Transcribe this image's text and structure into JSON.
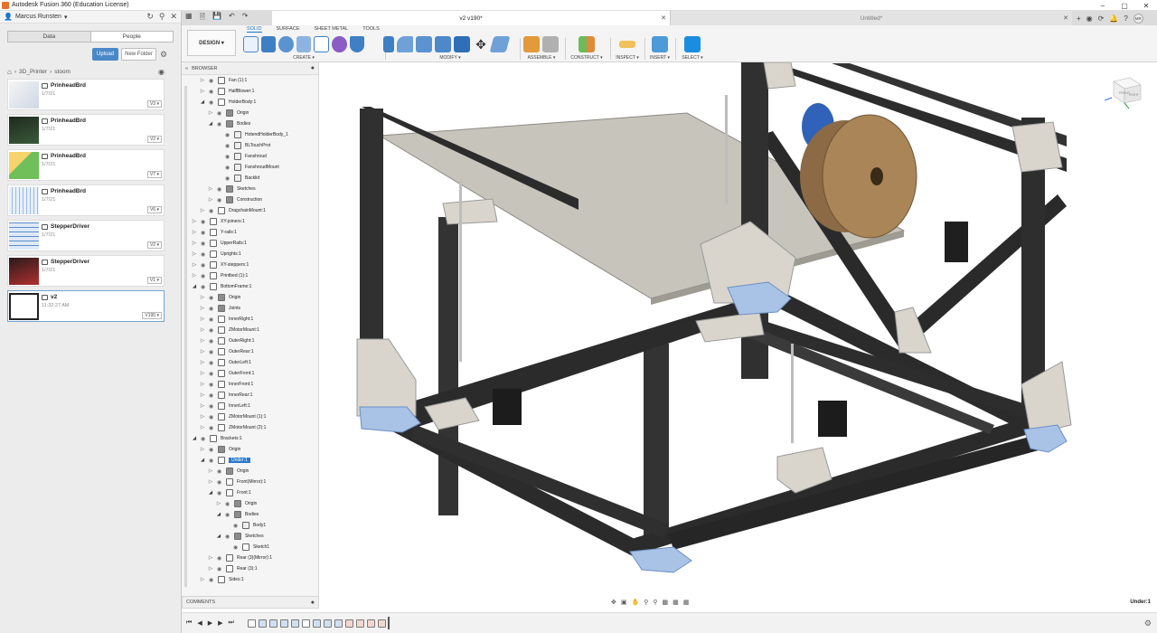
{
  "window": {
    "title": "Autodesk Fusion 360 (Education License)",
    "controls": [
      "–",
      "▢",
      "✕"
    ]
  },
  "data_panel": {
    "user": "Marcus Runsten",
    "tabs": [
      {
        "label": "Data",
        "active": true
      },
      {
        "label": "People",
        "active": false
      }
    ],
    "upload_label": "Upload",
    "new_folder_label": "New Folder",
    "breadcrumb": [
      "3D_Printer",
      "stoom"
    ],
    "files": [
      {
        "name": "PrinheadBrd",
        "date": "1/7/21",
        "version": "V3",
        "thumb": "pcb-sketch"
      },
      {
        "name": "PrinheadBrd",
        "date": "1/7/21",
        "version": "V2",
        "thumb": "pcb-dark"
      },
      {
        "name": "PrinheadBrd",
        "date": "1/7/21",
        "version": "V7",
        "thumb": "pcb-colored"
      },
      {
        "name": "PrinheadBrd",
        "date": "1/7/21",
        "version": "V6",
        "thumb": "pcb-schematic"
      },
      {
        "name": "StepperDriver",
        "date": "1/7/21",
        "version": "V2",
        "thumb": "schematic-blue"
      },
      {
        "name": "StepperDriver",
        "date": "1/7/21",
        "version": "V1",
        "thumb": "pcb-red"
      },
      {
        "name": "v2",
        "date": "11:32:27 AM",
        "version": "V190",
        "thumb": "frame-3d",
        "selected": true
      }
    ]
  },
  "doc_tabs": [
    {
      "label": "v2 v190*",
      "active": true
    },
    {
      "label": "Untitled*",
      "active": false
    }
  ],
  "user_initials": "MR",
  "toolbar": {
    "workspace_label": "DESIGN ▾",
    "workspace_tabs": [
      {
        "label": "SOLID",
        "active": true
      },
      {
        "label": "SURFACE",
        "active": false
      },
      {
        "label": "SHEET METAL",
        "active": false
      },
      {
        "label": "TOOLS",
        "active": false
      }
    ],
    "groups": [
      {
        "label": "CREATE ▾"
      },
      {
        "label": "MODIFY ▾"
      },
      {
        "label": "ASSEMBLE ▾"
      },
      {
        "label": "CONSTRUCT ▾"
      },
      {
        "label": "INSPECT ▾"
      },
      {
        "label": "INSERT ▾"
      },
      {
        "label": "SELECT ▾"
      }
    ]
  },
  "browser": {
    "title": "BROWSER",
    "tree": [
      {
        "label": "Fan (1):1",
        "depth": 3,
        "exp": "closed",
        "icon": "comp"
      },
      {
        "label": "HalfBlower:1",
        "depth": 3,
        "exp": "closed",
        "icon": "comp"
      },
      {
        "label": "HolderBody:1",
        "depth": 3,
        "exp": "open",
        "icon": "comp"
      },
      {
        "label": "Origin",
        "depth": 4,
        "exp": "closed",
        "icon": "folder"
      },
      {
        "label": "Bodies",
        "depth": 4,
        "exp": "open",
        "icon": "folder"
      },
      {
        "label": "HotendHolderBody_1",
        "depth": 5,
        "exp": "none",
        "icon": "body"
      },
      {
        "label": "BLTouchProt",
        "depth": 5,
        "exp": "none",
        "icon": "body"
      },
      {
        "label": "Fanshroud",
        "depth": 5,
        "exp": "none",
        "icon": "body"
      },
      {
        "label": "FanshroudMount",
        "depth": 5,
        "exp": "none",
        "icon": "body"
      },
      {
        "label": "Backlid",
        "depth": 5,
        "exp": "none",
        "icon": "body"
      },
      {
        "label": "Sketches",
        "depth": 4,
        "exp": "closed",
        "icon": "folder"
      },
      {
        "label": "Construction",
        "depth": 4,
        "exp": "closed",
        "icon": "folder"
      },
      {
        "label": "DragchainMount:1",
        "depth": 3,
        "exp": "closed",
        "icon": "comp"
      },
      {
        "label": "XY-joiners:1",
        "depth": 2,
        "exp": "closed",
        "icon": "link"
      },
      {
        "label": "Y-rails:1",
        "depth": 2,
        "exp": "closed",
        "icon": "link"
      },
      {
        "label": "UpperRails:1",
        "depth": 2,
        "exp": "closed",
        "icon": "link"
      },
      {
        "label": "Uprights:1",
        "depth": 2,
        "exp": "closed",
        "icon": "link"
      },
      {
        "label": "XY-steppers:1",
        "depth": 2,
        "exp": "closed",
        "icon": "link"
      },
      {
        "label": "Printbed (1):1",
        "depth": 2,
        "exp": "closed",
        "icon": "link"
      },
      {
        "label": "BottomFrame:1",
        "depth": 2,
        "exp": "open",
        "icon": "link"
      },
      {
        "label": "Origin",
        "depth": 3,
        "exp": "closed",
        "icon": "folder"
      },
      {
        "label": "Joints",
        "depth": 3,
        "exp": "closed",
        "icon": "folder"
      },
      {
        "label": "InnerRight:1",
        "depth": 3,
        "exp": "closed",
        "icon": "comp"
      },
      {
        "label": "ZMotorMount:1",
        "depth": 3,
        "exp": "closed",
        "icon": "comp"
      },
      {
        "label": "OuterRight:1",
        "depth": 3,
        "exp": "closed",
        "icon": "comp"
      },
      {
        "label": "OuterRear:1",
        "depth": 3,
        "exp": "closed",
        "icon": "comp"
      },
      {
        "label": "OuterLeft:1",
        "depth": 3,
        "exp": "closed",
        "icon": "comp"
      },
      {
        "label": "OuterFront:1",
        "depth": 3,
        "exp": "closed",
        "icon": "comp"
      },
      {
        "label": "InnerFront:1",
        "depth": 3,
        "exp": "closed",
        "icon": "comp"
      },
      {
        "label": "InnerRear:1",
        "depth": 3,
        "exp": "closed",
        "icon": "comp"
      },
      {
        "label": "InnerLeft:1",
        "depth": 3,
        "exp": "closed",
        "icon": "comp"
      },
      {
        "label": "ZMotorMount (1):1",
        "depth": 3,
        "exp": "closed",
        "icon": "comp"
      },
      {
        "label": "ZMotorMount (2):1",
        "depth": 3,
        "exp": "closed",
        "icon": "comp"
      },
      {
        "label": "Brackets:1",
        "depth": 2,
        "exp": "open",
        "icon": "link"
      },
      {
        "label": "Origin",
        "depth": 3,
        "exp": "closed",
        "icon": "folder"
      },
      {
        "label": "Under:1",
        "depth": 3,
        "exp": "open",
        "icon": "link",
        "selected": true
      },
      {
        "label": "Origin",
        "depth": 4,
        "exp": "closed",
        "icon": "folder"
      },
      {
        "label": "Front(Mirror):1",
        "depth": 4,
        "exp": "closed",
        "icon": "comp"
      },
      {
        "label": "Front:1",
        "depth": 4,
        "exp": "open",
        "icon": "comp"
      },
      {
        "label": "Origin",
        "depth": 5,
        "exp": "closed",
        "icon": "folder"
      },
      {
        "label": "Bodies",
        "depth": 5,
        "exp": "open",
        "icon": "folder"
      },
      {
        "label": "Body1",
        "depth": 6,
        "exp": "none",
        "icon": "body"
      },
      {
        "label": "Sketches",
        "depth": 5,
        "exp": "open",
        "icon": "folder"
      },
      {
        "label": "Sketch1",
        "depth": 6,
        "exp": "none",
        "icon": "sketch"
      },
      {
        "label": "Rear (3)(Mirror):1",
        "depth": 4,
        "exp": "closed",
        "icon": "comp"
      },
      {
        "label": "Rear (3):1",
        "depth": 4,
        "exp": "closed",
        "icon": "comp"
      },
      {
        "label": "Sides:1",
        "depth": 3,
        "exp": "closed",
        "icon": "link"
      }
    ]
  },
  "comments_label": "COMMENTS",
  "status_selection": "Under:1",
  "viewcube": {
    "front": "FRONT",
    "right": "RIGHT"
  },
  "colors": {
    "accent": "#1a75c4",
    "frame": "#2a2a2a",
    "bracket": "#d8d4cc",
    "foot": "#a9c2e4",
    "bed": "#c9c6bd",
    "spool": "#8b6a45"
  }
}
